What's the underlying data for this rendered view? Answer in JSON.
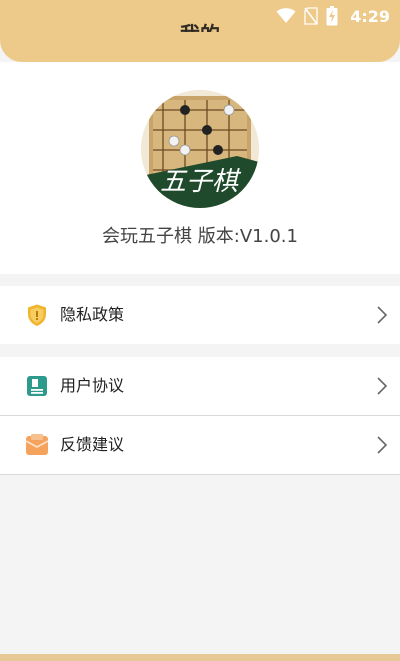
{
  "header": {
    "title": "我的"
  },
  "status": {
    "time": "4:29"
  },
  "profile": {
    "version_text": "会玩五子棋 版本:V1.0.1",
    "logo_text": "五子棋"
  },
  "menu": {
    "privacy": "隐私政策",
    "agreement": "用户协议",
    "feedback": "反馈建议"
  },
  "colors": {
    "header": "#edc98a",
    "privacy_icon": "#f0b52e",
    "agreement_icon": "#2e9a8c",
    "feedback_icon": "#f5a35c"
  }
}
